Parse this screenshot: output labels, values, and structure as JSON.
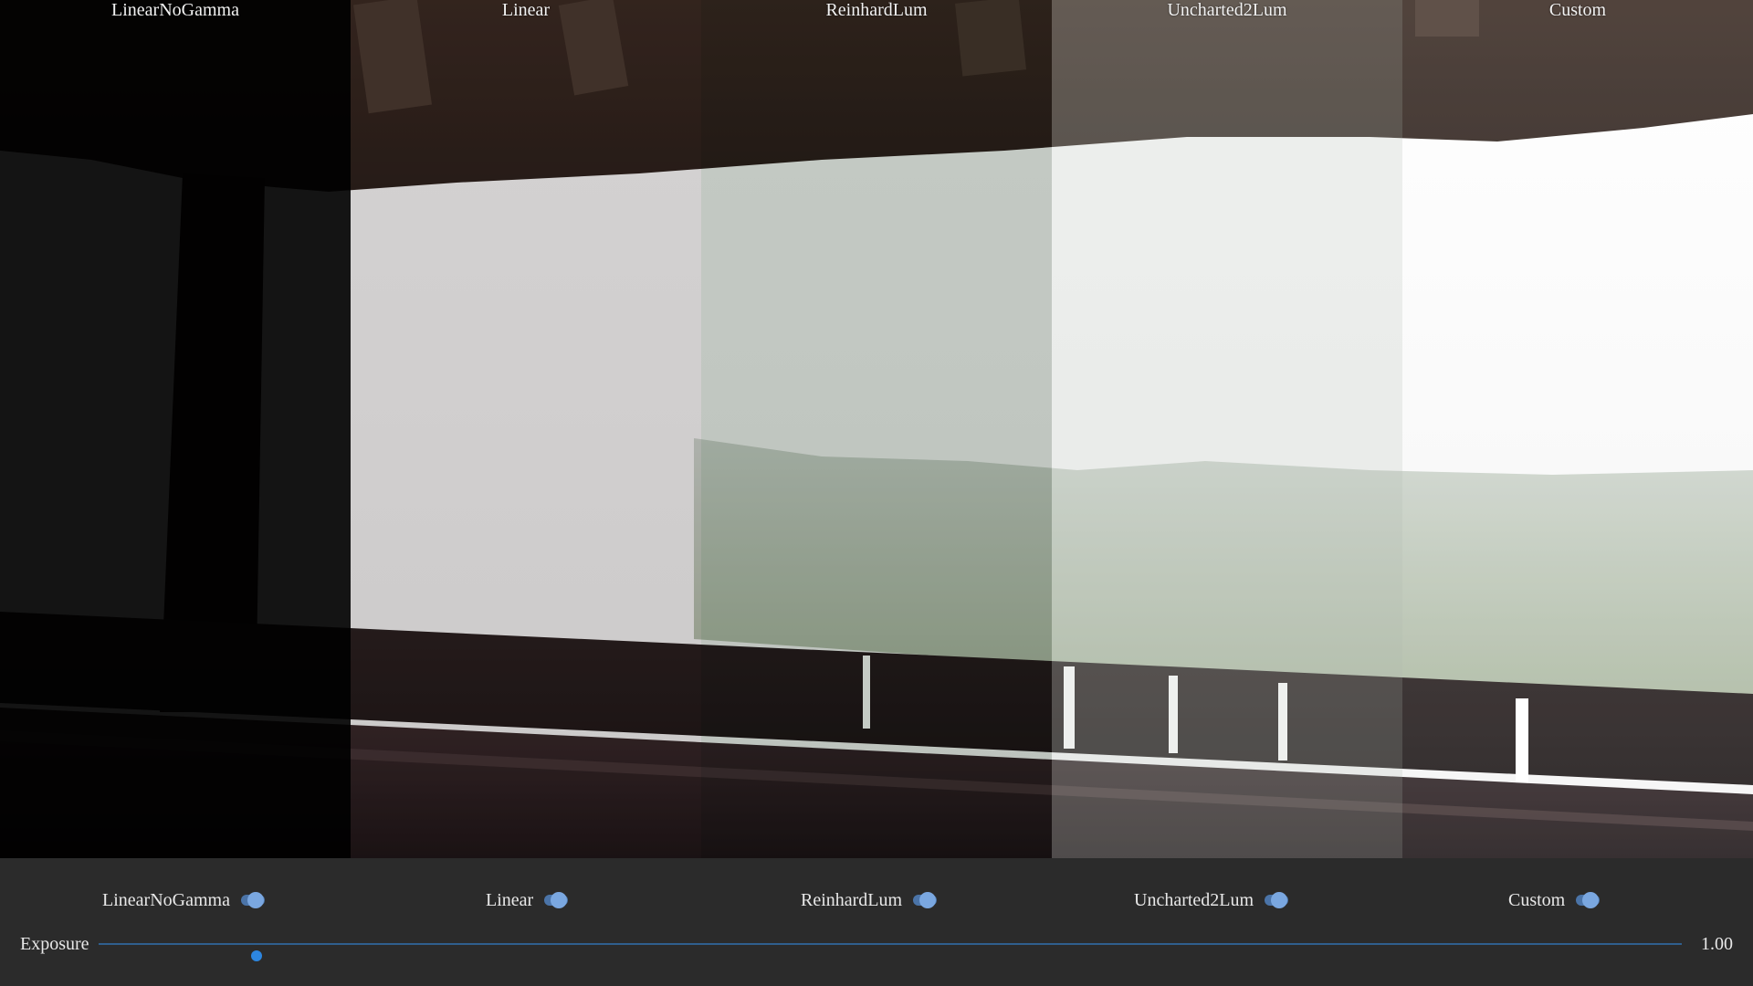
{
  "strips": [
    {
      "id": "linear-no-gamma",
      "label": "LinearNoGamma"
    },
    {
      "id": "linear",
      "label": "Linear"
    },
    {
      "id": "reinhard-lum",
      "label": "ReinhardLum"
    },
    {
      "id": "uncharted2-lum",
      "label": "Uncharted2Lum"
    },
    {
      "id": "custom",
      "label": "Custom"
    }
  ],
  "toggles": [
    {
      "label": "LinearNoGamma",
      "checked": true
    },
    {
      "label": "Linear",
      "checked": true
    },
    {
      "label": "ReinhardLum",
      "checked": true
    },
    {
      "label": "Uncharted2Lum",
      "checked": true
    },
    {
      "label": "Custom",
      "checked": true
    }
  ],
  "exposure": {
    "label": "Exposure",
    "value_text": "1.00",
    "fraction": 0.1
  },
  "colors": {
    "accent": "#2d86e0",
    "toggle_knob": "#7aa7e0",
    "panel_bg": "#2b2b2b"
  }
}
